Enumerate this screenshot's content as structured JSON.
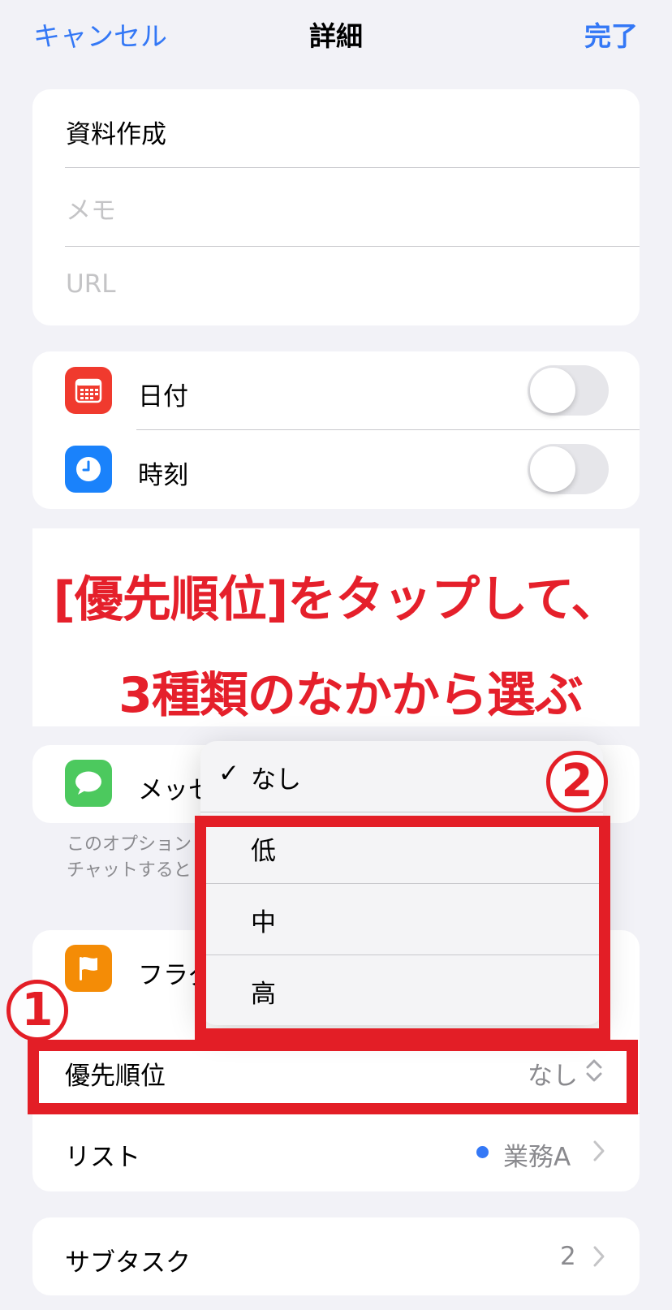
{
  "nav": {
    "cancel": "キャンセル",
    "title": "詳細",
    "done": "完了"
  },
  "details": {
    "title": "資料作成",
    "memo_placeholder": "メモ",
    "url_placeholder": "URL"
  },
  "date_time": {
    "date_label": "日付",
    "date_on": false,
    "time_label": "時刻",
    "time_on": false
  },
  "annotation": {
    "line1": "[優先順位]をタップして、",
    "line2": "3種類のなかから選ぶ",
    "marker1": "1",
    "marker2": "2"
  },
  "messages": {
    "label": "メッセ",
    "footnote_line1": "このオプション",
    "footnote_line2": "チャットすると"
  },
  "flag": {
    "label": "フラグ"
  },
  "priority": {
    "label": "優先順位",
    "value": "なし"
  },
  "list": {
    "label": "リスト",
    "value": "業務A",
    "dot_color": "#3478f6"
  },
  "subtask": {
    "label": "サブタスク",
    "count": "2"
  },
  "menu": {
    "check": "✓",
    "items": [
      "なし",
      "低",
      "中",
      "高"
    ]
  },
  "colors": {
    "accent": "#3478f6",
    "annotation_red": "#e31e26",
    "calendar": "#f03a2e",
    "clock": "#1a82fb",
    "messages": "#4cc95e",
    "flag": "#f48c06"
  }
}
